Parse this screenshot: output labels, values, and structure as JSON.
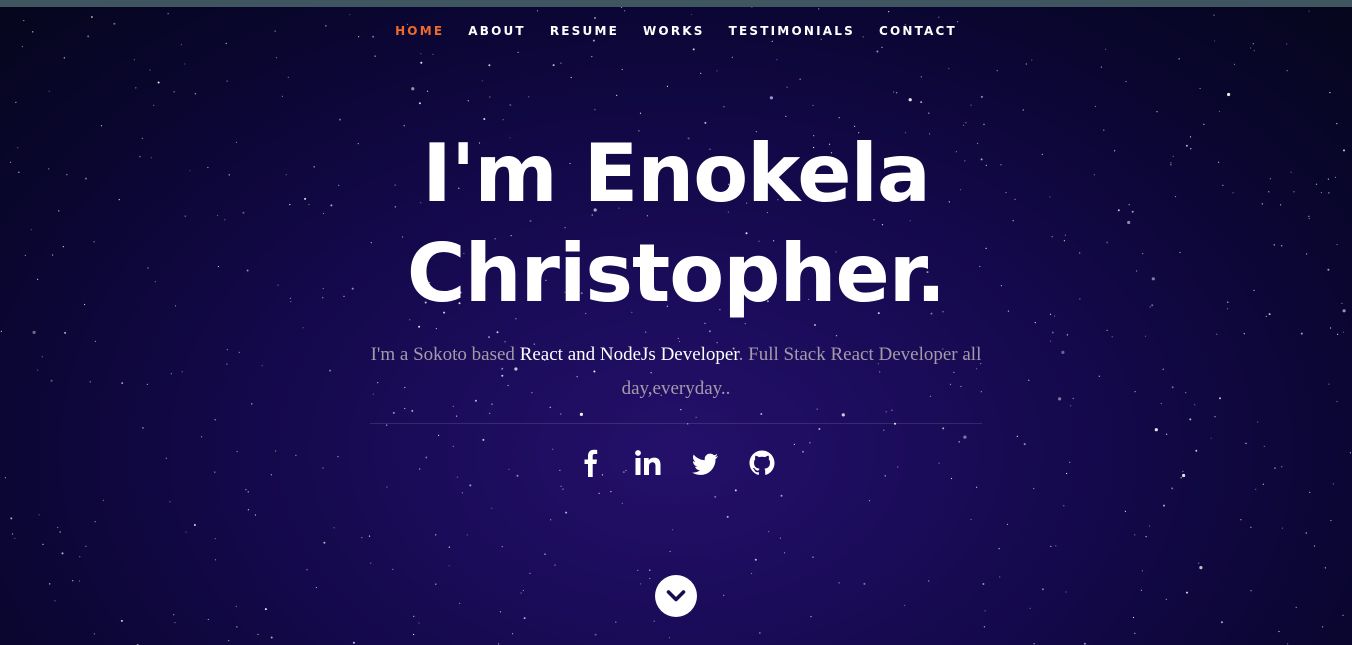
{
  "nav": {
    "items": [
      {
        "label": "HOME",
        "active": true
      },
      {
        "label": "ABOUT",
        "active": false
      },
      {
        "label": "RESUME",
        "active": false
      },
      {
        "label": "WORKS",
        "active": false
      },
      {
        "label": "TESTIMONIALS",
        "active": false
      },
      {
        "label": "CONTACT",
        "active": false
      }
    ]
  },
  "hero": {
    "headline_line1": "I'm Enokela",
    "headline_line2": "Christopher.",
    "intro_prefix": "I'm a Sokoto based ",
    "intro_highlight": "React and NodeJs Developer",
    "intro_suffix": ". Full Stack React Developer all day,everyday.."
  },
  "social": [
    {
      "name": "facebook-icon"
    },
    {
      "name": "linkedin-icon"
    },
    {
      "name": "twitter-icon"
    },
    {
      "name": "github-icon"
    }
  ],
  "colors": {
    "accent": "#ee6b2b",
    "topbar": "#3f5560",
    "background_center": "#24106a",
    "background_edge": "#06061c",
    "intro_text": "#a49ba9",
    "scroll_icon": "#1a0d4f"
  },
  "scroll_down": {
    "icon": "chevron-down-icon"
  }
}
